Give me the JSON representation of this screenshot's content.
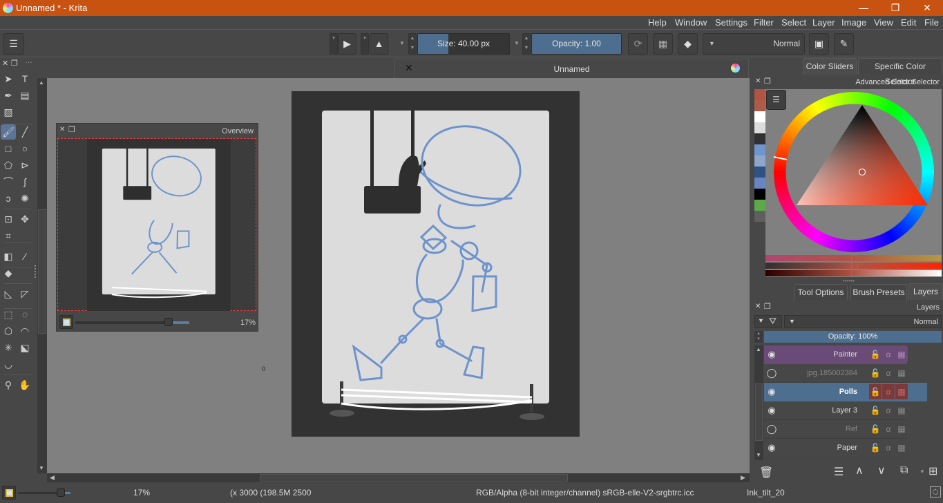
{
  "window": {
    "title": "Unnamed * - Krita",
    "minimize": "—",
    "restore": "❐",
    "close": "✕"
  },
  "menu": [
    "Help",
    "Window",
    "Settings",
    "Filter",
    "Select",
    "Layer",
    "Image",
    "View",
    "Edit",
    "File"
  ],
  "toolbar": {
    "size_label": "Size:  40.00 px",
    "size_fraction": 0.33,
    "opacity_label": "Opacity:  1.00",
    "opacity_fraction": 1.0,
    "blend_mode": "Normal",
    "fg_color": "#b05444",
    "bg_color": "#ffffff"
  },
  "document_tab": {
    "title": "Unnamed"
  },
  "toolbox": {
    "tools": [
      {
        "name": "select-shapes",
        "glyph": "➤"
      },
      {
        "name": "text",
        "glyph": "T"
      },
      {
        "name": "edit-shapes",
        "glyph": "✒"
      },
      {
        "name": "calligraphy",
        "glyph": "▤"
      },
      {
        "name": "pattern-edit",
        "glyph": "▨"
      },
      {
        "name": "freehand-brush",
        "glyph": "🖌"
      },
      {
        "name": "line",
        "glyph": "╱"
      },
      {
        "name": "rectangle",
        "glyph": "□"
      },
      {
        "name": "ellipse",
        "glyph": "○"
      },
      {
        "name": "polygon",
        "glyph": "⬠"
      },
      {
        "name": "polyline",
        "glyph": "⊳"
      },
      {
        "name": "bezier-curve",
        "glyph": "⌒"
      },
      {
        "name": "freehand-path",
        "glyph": "ʃ"
      },
      {
        "name": "dynamic-brush",
        "glyph": "ↄ"
      },
      {
        "name": "multibrush",
        "glyph": "✺"
      },
      {
        "name": "transform",
        "glyph": "⊡"
      },
      {
        "name": "move",
        "glyph": "✥"
      },
      {
        "name": "crop",
        "glyph": "⌗"
      },
      {
        "name": "gradient",
        "glyph": "◧"
      },
      {
        "name": "color-picker",
        "glyph": "⁄"
      },
      {
        "name": "fill",
        "glyph": "◆"
      },
      {
        "name": "assistant",
        "glyph": "◺"
      },
      {
        "name": "measure",
        "glyph": "◸"
      },
      {
        "name": "rect-select",
        "glyph": "⬚"
      },
      {
        "name": "ellipse-select",
        "glyph": "◌"
      },
      {
        "name": "polygon-select",
        "glyph": "⬡"
      },
      {
        "name": "freehand-select",
        "glyph": "◠"
      },
      {
        "name": "contiguous-select",
        "glyph": "✳"
      },
      {
        "name": "similar-select",
        "glyph": "⬕"
      },
      {
        "name": "bezier-select",
        "glyph": "◡"
      },
      {
        "name": "zoom",
        "glyph": "⚲"
      },
      {
        "name": "pan",
        "glyph": "✋"
      }
    ]
  },
  "overview": {
    "title": "Overview",
    "zoom_label": "17%",
    "zoom_fraction": 0.82
  },
  "color_dock": {
    "tabs": [
      "Color Sliders",
      "Specific Color Selector"
    ],
    "title": "Advanced Color Selector",
    "swatches": [
      "#b05444",
      "#b05a4a",
      "#ffffff",
      "#dcdcdc",
      "#313131",
      "#7095cc",
      "#8ea6cc",
      "#2f5283",
      "#6586c0",
      "#000000",
      "#5baa48",
      "#5f5f5f"
    ],
    "hue_angle_deg": 195
  },
  "layers_dock": {
    "tabs": [
      "Tool Options",
      "Brush Presets",
      "Layers"
    ],
    "title": "Layers",
    "blend_mode": "Normal",
    "opacity_label": "Opacity:  100%",
    "layers": [
      {
        "name": "Painter",
        "style": "group-purple",
        "visible": true
      },
      {
        "name": "jpg.185002384",
        "style": "dim",
        "visible": false
      },
      {
        "name": "Polls",
        "style": "selected",
        "visible": true
      },
      {
        "name": "Layer 3",
        "style": "normal",
        "visible": true
      },
      {
        "name": "Ref",
        "style": "dim",
        "visible": false
      },
      {
        "name": "Paper",
        "style": "normal",
        "visible": true
      }
    ]
  },
  "statusbar": {
    "zoom_label": "17%",
    "zoom_fraction": 0.82,
    "dimensions": "(x 3000 (198.5M 2500",
    "color_profile": "RGB/Alpha (8-bit integer/channel)  sRGB-elle-V2-srgbtrc.icc",
    "brush_preset": "Ink_tilt_20"
  },
  "canvas_marker": "0"
}
